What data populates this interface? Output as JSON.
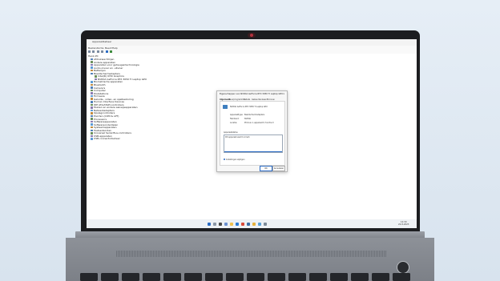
{
  "window": {
    "title": "Apparaatbeheer",
    "menu": [
      "Bestand",
      "Actie",
      "Beeld",
      "Help"
    ]
  },
  "device_tree": {
    "computer": "Henk-PC",
    "items": [
      "Afdrukwachtrijen",
      "Andere apparaten",
      "Apparaten voor geheugentechnologie",
      "Audio-invoer en -uitvoer",
      "Batterijen",
      "Beeldschermadapters",
      "Intel(R) UHD Graphics",
      "NVIDIA GeForce RTX 3050 Ti Laptop GPU",
      "Biometrische apparaten",
      "Bluetooth",
      "Camera's",
      "Computer",
      "Diskstations",
      "Firmware",
      "Geluids-, video- en spelbesturing",
      "Human Interface Devices",
      "IDE ATA/ATAPI-controllers",
      "Muizen en andere aanwijsapparaten",
      "Netwerkadapters",
      "Opslagcontrollers",
      "Poorten (COM & LPT)",
      "Processors",
      "Softwareapparaten",
      "Softwareonderdelen",
      "Systeemapparaten",
      "Toetsenborden",
      "Universal Serial Bus-controllers",
      "USB-apparaten",
      "USB-connectorbeheer"
    ]
  },
  "dialog": {
    "title": "Eigenschappen van NVIDIA GeForce RTX 3050 Ti Laptop GPU",
    "tabs": [
      "Algemeen",
      "Stuurprogramma",
      "Details",
      "Gebeurtenissen",
      "Bronnen"
    ],
    "device_name": "NVIDIA GeForce RTX 3050 Ti Laptop GPU",
    "fields": [
      {
        "label": "Apparaattype:",
        "value": "Beeldschermadapters"
      },
      {
        "label": "Fabrikant:",
        "value": "NVIDIA"
      },
      {
        "label": "Locatie:",
        "value": "PCI-bus 1, apparaat 0, functie 0"
      }
    ],
    "status_heading": "Apparaatstatus",
    "status_text": "Dit apparaat werkt correct.",
    "extra_link": "Instellingen wijzigen",
    "ok_label": "OK",
    "cancel_label": "Annuleren"
  },
  "taskbar": {
    "time": "12:30",
    "date": "22-8-2023"
  },
  "colors": {
    "background": "#dfe9f3",
    "accent": "#2b6bc4",
    "laptop_body": "#8a8e95"
  }
}
